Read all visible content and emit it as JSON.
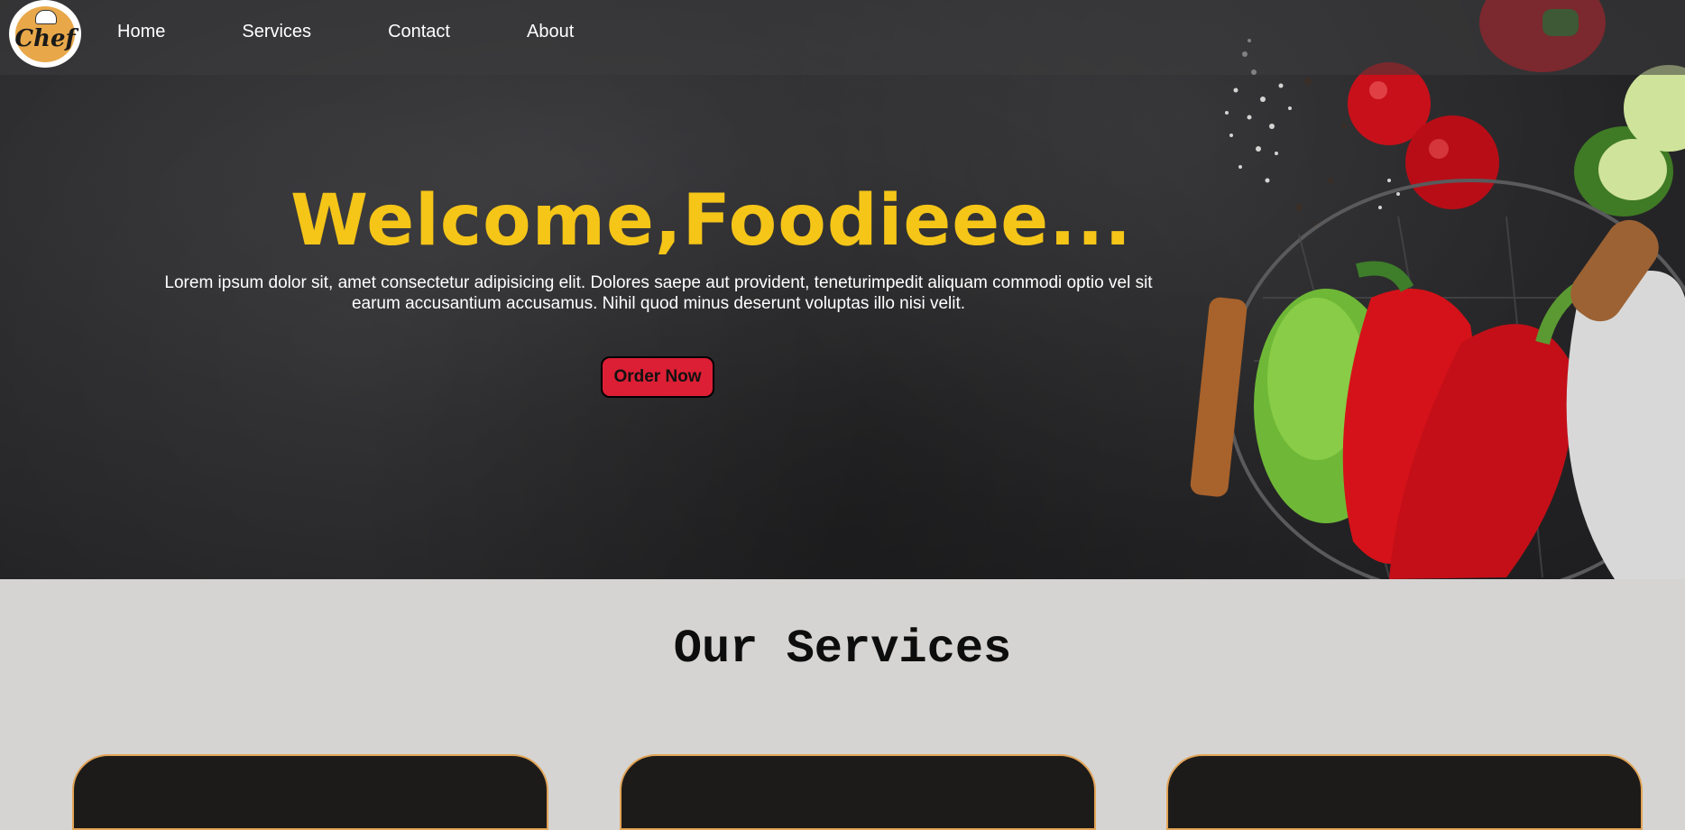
{
  "logo": {
    "text": "Chef"
  },
  "nav": {
    "items": [
      {
        "label": "Home"
      },
      {
        "label": "Services"
      },
      {
        "label": "Contact"
      },
      {
        "label": "About"
      }
    ]
  },
  "hero": {
    "heading": "Welcome,Foodieee...",
    "paragraph": "Lorem ipsum dolor sit, amet consectetur adipisicing elit. Dolores saepe aut provident, teneturimpedit aliquam commodi optio vel sit earum accusantium accusamus. Nihil quod minus deserunt voluptas illo nisi velit.",
    "order_button": "Order Now"
  },
  "services": {
    "title": "Our Services",
    "cards": [
      {},
      {},
      {}
    ]
  },
  "colors": {
    "heading": "#f5c518",
    "button": "#dc1f35",
    "services_bg": "#d5d4d3",
    "card_bg": "#1d1b1a",
    "card_border": "#e2a457"
  }
}
